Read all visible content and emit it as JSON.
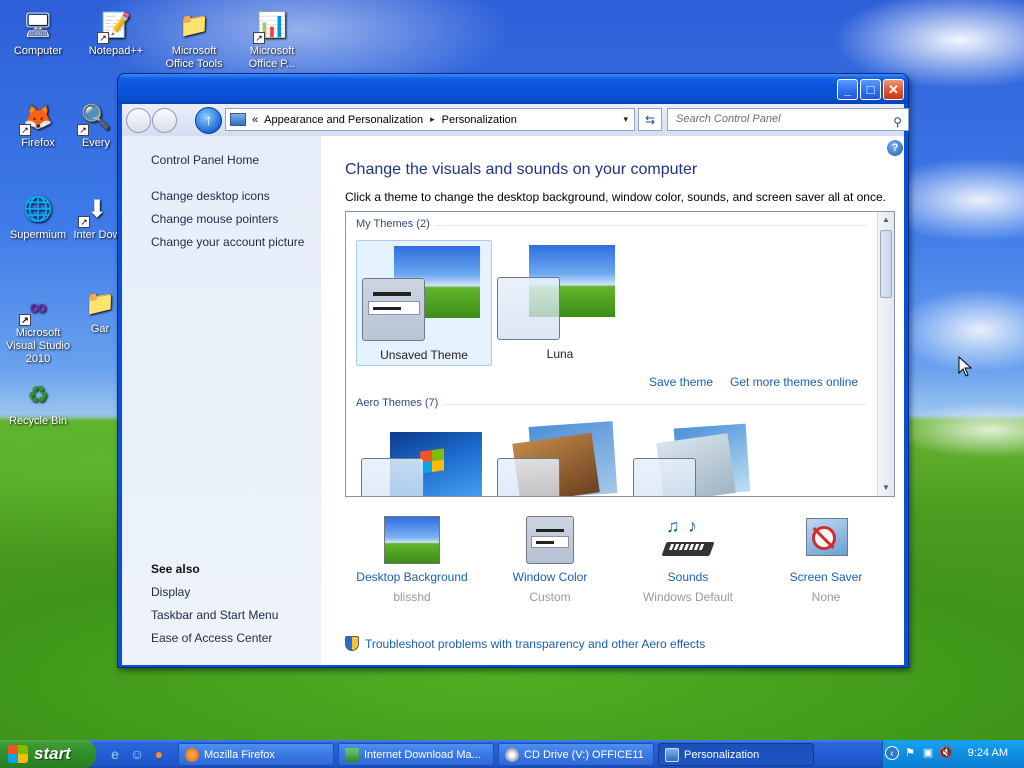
{
  "desktop": {
    "icons": [
      {
        "label": "Computer",
        "glyph": "🖥"
      },
      {
        "label": "Notepad++",
        "glyph": "📝"
      },
      {
        "label": "Microsoft Office Tools",
        "glyph": "📁"
      },
      {
        "label": "Microsoft Office P...",
        "glyph": "📊"
      },
      {
        "label": "Firefox",
        "glyph": "🦊"
      },
      {
        "label": "Every",
        "glyph": "🔍"
      },
      {
        "label": "Supermium",
        "glyph": "🌐"
      },
      {
        "label": "Inter Dow",
        "glyph": "⬇"
      },
      {
        "label": "Microsoft Visual Studio 2010",
        "glyph": "∞"
      },
      {
        "label": "Gar",
        "glyph": "📁"
      },
      {
        "label": "Recycle Bin",
        "glyph": "♻"
      }
    ]
  },
  "window": {
    "controls": {
      "minimize": "_",
      "maximize": "□",
      "close": "✕"
    },
    "address": {
      "prefix": "«",
      "crumb1": "Appearance and Personalization",
      "separator": "▸",
      "crumb2": "Personalization",
      "dropdown": "▾"
    },
    "refresh_glyph": "⇆",
    "search": {
      "placeholder": "Search Control Panel",
      "icon": "⚲"
    },
    "help_glyph": "?"
  },
  "left_pane": {
    "home": "Control Panel Home",
    "links": [
      "Change desktop icons",
      "Change mouse pointers",
      "Change your account picture"
    ],
    "see_also_title": "See also",
    "see_also": [
      "Display",
      "Taskbar and Start Menu",
      "Ease of Access Center"
    ]
  },
  "main": {
    "title": "Change the visuals and sounds on your computer",
    "subtitle": "Click a theme to change the desktop background, window color, sounds, and screen saver all at once.",
    "my_themes_label": "My Themes (2)",
    "my_themes": [
      {
        "name": "Unsaved Theme",
        "selected": true
      },
      {
        "name": "Luna",
        "selected": false
      }
    ],
    "save_theme": "Save theme",
    "get_more": "Get more themes online",
    "aero_themes_label": "Aero Themes (7)"
  },
  "bottom": [
    {
      "label": "Desktop Background",
      "sub": "blisshd"
    },
    {
      "label": "Window Color",
      "sub": "Custom"
    },
    {
      "label": "Sounds",
      "sub": "Windows Default"
    },
    {
      "label": "Screen Saver",
      "sub": "None"
    }
  ],
  "troubleshoot": "Troubleshoot problems with transparency and other Aero effects",
  "taskbar": {
    "start_label": "start",
    "buttons": [
      {
        "label": "Mozilla Firefox",
        "active": false
      },
      {
        "label": "Internet Download Ma...",
        "active": false
      },
      {
        "label": "CD Drive (V:) OFFICE11",
        "active": false
      },
      {
        "label": "Personalization",
        "active": true
      }
    ],
    "clock": "9:24 AM"
  },
  "colors": {
    "link": "#1a5fb4",
    "title_blue": "#1e3287",
    "titlebar": "#0a52d8",
    "taskbar": "#245dd4",
    "start_green": "#3c9a33",
    "tray": "#0f8fe2"
  }
}
